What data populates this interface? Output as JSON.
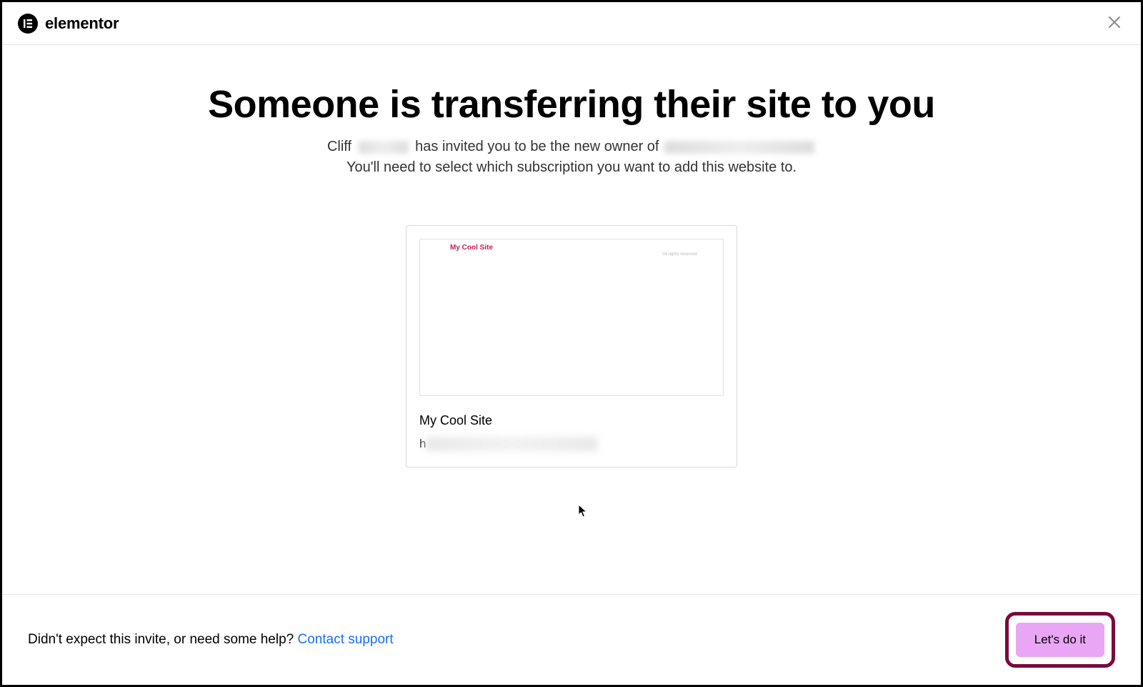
{
  "brand": {
    "name": "elementor"
  },
  "header": {
    "close_label": "Close"
  },
  "main": {
    "title": "Someone is transferring their site to you",
    "subtitle_prefix": "Cliff ",
    "subtitle_mid": " has invited you to be the new owner of ",
    "subtitle_line2": "You'll need to select which subscription you want to add this website to."
  },
  "site_card": {
    "preview_brand": "My Cool Site",
    "preview_footer": "All rights reserved.",
    "title": "My Cool Site",
    "url_first_char": "h"
  },
  "footer": {
    "help_prefix": "Didn't expect this invite, or need some help? ",
    "help_link": "Contact support",
    "cta_label": "Let's do it"
  }
}
